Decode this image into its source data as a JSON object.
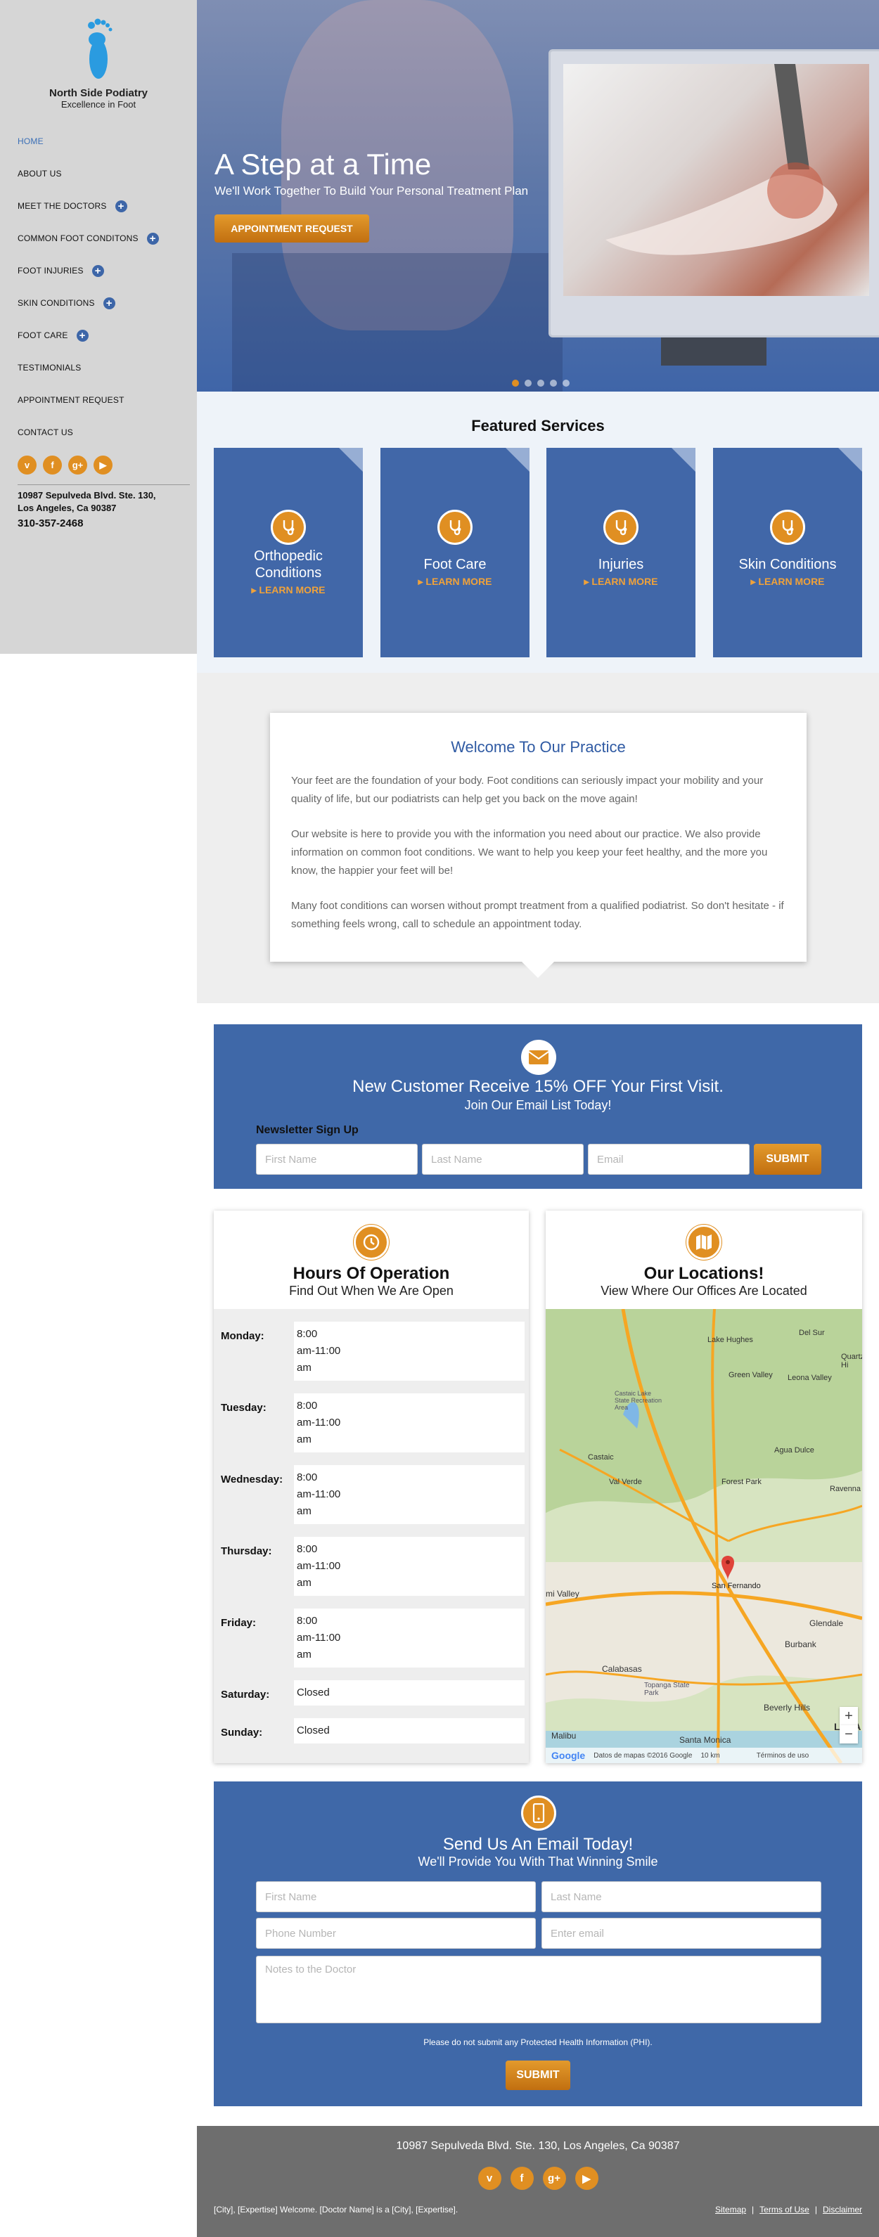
{
  "brand": {
    "name": "North Side Podiatry",
    "tagline": "Excellence in Foot",
    "accent": "#e08f22",
    "blue": "#3f68a8"
  },
  "nav": [
    {
      "label": "HOME",
      "active": true,
      "expand": false
    },
    {
      "label": "ABOUT US",
      "expand": false
    },
    {
      "label": "MEET THE DOCTORS",
      "expand": true
    },
    {
      "label": "COMMON FOOT CONDITONS",
      "expand": true
    },
    {
      "label": "FOOT INJURIES",
      "expand": true
    },
    {
      "label": "SKIN CONDITIONS",
      "expand": true
    },
    {
      "label": "FOOT CARE",
      "expand": true
    },
    {
      "label": "TESTIMONIALS",
      "expand": false
    },
    {
      "label": "APPOINTMENT REQUEST",
      "expand": false
    },
    {
      "label": "CONTACT US",
      "expand": false
    }
  ],
  "social": {
    "vimeo": "v",
    "facebook": "f",
    "google": "g+",
    "youtube": "▶"
  },
  "sidebar": {
    "address_line1": "10987 Sepulveda Blvd. Ste. 130,",
    "address_line2": "Los Angeles, Ca 90387",
    "phone": "310-357-2468"
  },
  "hero": {
    "title": "A Step at a Time",
    "subtitle": "We'll Work Together To Build Your Personal Treatment Plan",
    "button": "APPOINTMENT REQUEST",
    "slides": 5,
    "active_slide": 1
  },
  "featured": {
    "heading": "Featured Services",
    "learn_more": "▸ LEARN MORE",
    "cards": [
      {
        "title": "Orthopedic Conditions"
      },
      {
        "title": "Foot Care"
      },
      {
        "title": "Injuries"
      },
      {
        "title": "Skin Conditions"
      }
    ]
  },
  "welcome": {
    "heading": "Welcome To Our Practice",
    "paragraphs": [
      "Your feet are the foundation of your body. Foot conditions can seriously impact your mobility and your quality of life, but our podiatrists can help get you back on the move again!",
      "Our website is here to provide you with the information you need about our practice. We also provide information on common foot conditions. We want to help you keep your feet healthy, and the more you know, the happier your feet will be!",
      "Many foot conditions can worsen without prompt treatment from a qualified podiatrist. So don't hesitate - if something feels wrong, call to schedule an appointment today."
    ]
  },
  "promo": {
    "heading": "New Customer Receive 15% OFF Your First Visit.",
    "subheading": "Join Our Email List Today!",
    "newsletter_label": "Newsletter Sign Up",
    "first_name_placeholder": "First Name",
    "last_name_placeholder": "Last Name",
    "email_placeholder": "Email",
    "submit": "SUBMIT"
  },
  "hours": {
    "heading": "Hours Of Operation",
    "subheading": "Find Out When We Are Open",
    "rows": [
      {
        "day": "Monday:",
        "value": "8:00\nam-11:00\nam"
      },
      {
        "day": "Tuesday:",
        "value": "8:00\nam-11:00\nam"
      },
      {
        "day": "Wednesday:",
        "value": "8:00\nam-11:00\nam"
      },
      {
        "day": "Thursday:",
        "value": "8:00\nam-11:00\nam"
      },
      {
        "day": "Friday:",
        "value": "8:00\nam-11:00\nam"
      },
      {
        "day": "Saturday:",
        "value": "Closed"
      },
      {
        "day": "Sunday:",
        "value": "Closed"
      }
    ]
  },
  "locations": {
    "heading": "Our Locations!",
    "subheading": "View Where Our Offices Are Located",
    "map_labels": [
      "Lake Hughes",
      "Green Valley",
      "Leona Valley",
      "Del Sur",
      "Quartz Hi",
      "Castaic",
      "Castaic Lake State Recreation Area",
      "Agua Dulce",
      "Val Verde",
      "Forest Park",
      "Ravenna",
      "San Fernando",
      "mi Valley",
      "Burbank",
      "Glendale",
      "Calabasas",
      "Topanga State Park",
      "Beverly Hills",
      "Malibu",
      "Santa Monica",
      "Los A"
    ],
    "map_credit": "Datos de mapas ©2016 Google",
    "map_scale": "10 km",
    "map_terms": "Términos de uso",
    "google": "Google",
    "zoom_in": "+",
    "zoom_out": "−"
  },
  "email_form": {
    "heading": "Send Us An Email Today!",
    "subheading": "We'll Provide You With That Winning Smile",
    "first_name_placeholder": "First Name",
    "last_name_placeholder": "Last Name",
    "phone_placeholder": "Phone Number",
    "email_placeholder": "Enter email",
    "notes_placeholder": "Notes to the Doctor",
    "phi_notice": "Please do not submit any Protected Health Information (PHI).",
    "submit": "SUBMIT"
  },
  "footer": {
    "address": "10987 Sepulveda Blvd. Ste. 130, Los Angeles, Ca 90387",
    "left_text": "[City], [Expertise] Welcome. [Doctor Name] is a [City], [Expertise].",
    "links": [
      "Sitemap",
      "Terms of Use",
      "Disclaimer"
    ],
    "separator": "|"
  }
}
